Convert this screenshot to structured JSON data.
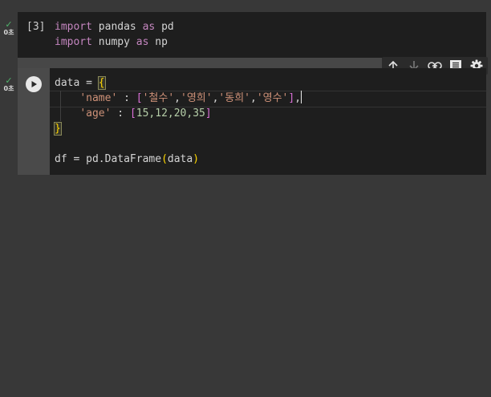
{
  "cell1": {
    "status_check": "✓",
    "exec_time": "0초",
    "exec_count": "[3]",
    "lines": [
      {
        "kw1": "import",
        "mod": " pandas ",
        "kw2": "as",
        "alias": " pd"
      },
      {
        "kw1": "import",
        "mod": " numpy ",
        "kw2": "as",
        "alias": " np"
      }
    ]
  },
  "cell2": {
    "status_check": "✓",
    "exec_time": "0초",
    "code": {
      "line1_pre": "data = ",
      "line1_brace": "{",
      "line2_key": "'name'",
      "line2_colon": " : ",
      "line2_open": "[",
      "line2_v1": "'철수'",
      "line2_v2": "'영희'",
      "line2_v3": "'동희'",
      "line2_v4": "'영수'",
      "line2_close": "]",
      "comma": ",",
      "line3_key": "'age'",
      "line3_colon": " : ",
      "line3_open": "[",
      "line3_values": "15,12,20,35",
      "line3_close": "]",
      "line4_brace": "}",
      "line6_pre": "df = pd.DataFrame",
      "line6_open": "(",
      "line6_arg": "data",
      "line6_close": ")"
    }
  },
  "toolbar": {
    "icons": [
      "arrow-up-icon",
      "arrow-down-icon",
      "link-icon",
      "comment-icon",
      "gear-icon"
    ]
  }
}
